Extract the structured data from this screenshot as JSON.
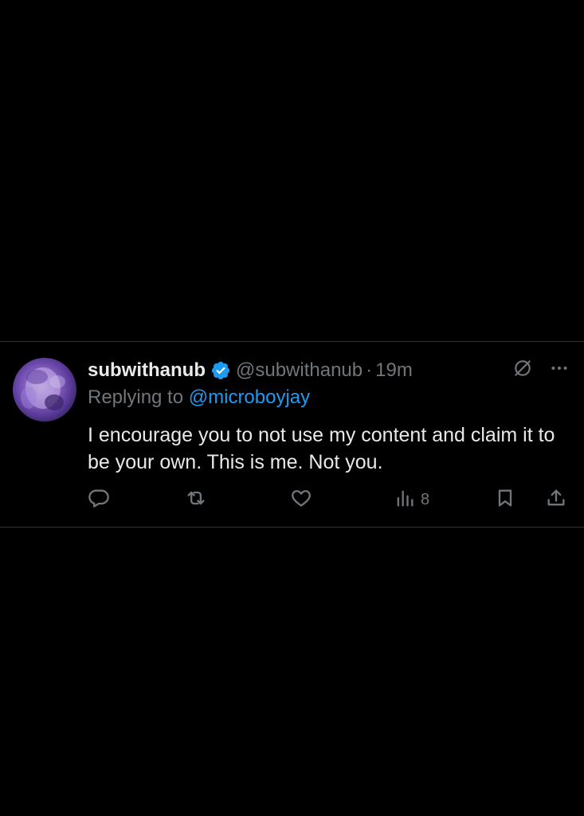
{
  "tweet": {
    "display_name": "subwithanub",
    "handle": "@subwithanub",
    "separator": "·",
    "time": "19m",
    "reply_prefix": "Replying to",
    "reply_to": "@microboyjay",
    "text": "I encourage you to not use my content and claim it to be your own. This is me. Not you."
  },
  "actions": {
    "views_count": "8"
  },
  "icons": {
    "verified": "verified-badge-icon",
    "grok": "grok-icon",
    "more": "more-icon",
    "reply": "reply-icon",
    "retweet": "retweet-icon",
    "like": "like-icon",
    "views": "views-icon",
    "bookmark": "bookmark-icon",
    "share": "share-icon"
  },
  "colors": {
    "background": "#000000",
    "text_primary": "#e7e9ea",
    "text_secondary": "#71767b",
    "accent": "#1d9bf0",
    "divider": "#2f3336"
  }
}
